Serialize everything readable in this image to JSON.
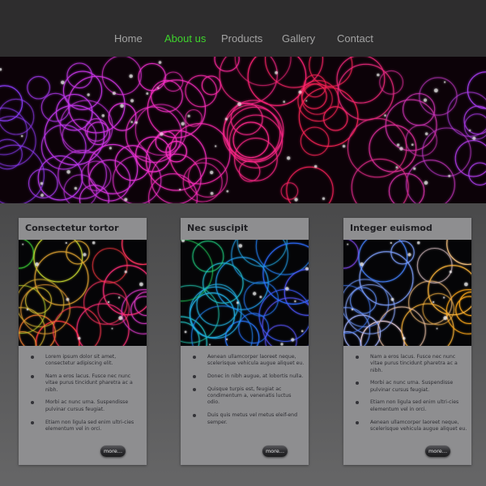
{
  "nav": {
    "items": [
      {
        "label": "Home",
        "active": false
      },
      {
        "label": "About us",
        "active": true
      },
      {
        "label": "Products",
        "active": false
      },
      {
        "label": "Gallery",
        "active": false
      },
      {
        "label": "Contact",
        "active": false
      }
    ],
    "active_color": "#3ed42c",
    "inactive_color": "#a3a3a3"
  },
  "banner": {
    "image": "glowing-circles-world-map",
    "palette": [
      "#8a3cff",
      "#ff2fd0",
      "#ff2050",
      "#b040ff"
    ]
  },
  "cards": [
    {
      "title": "Consectetur tortor",
      "image": "glowing-circles-rainbow",
      "items": [
        "Lorem ipsum dolor sit amet, consectetur adipiscing elit.",
        "Nam a eros lacus. Fusce nec nunc vitae purus tincidunt pharetra ac a nibh.",
        "Morbi ac nunc urna. Suspendisse pulvinar cursus feugiat.",
        "Etiam non ligula sed enim ultri-cies elementum vel in orci."
      ],
      "more_label": "more..."
    },
    {
      "title": "Nec suscipit",
      "image": "glowing-circles-green-blue",
      "items": [
        "Aenean ullamcorper laoreet neque, scelerisque vehicula augue aliquet eu.",
        "Donec in nibh augue, at lobortis nulla.",
        "Quisque turpis est, feugiat ac condimentum a, venenatis luctus odio.",
        "Duis quis metus vel metus eleif-end semper."
      ],
      "more_label": "more..."
    },
    {
      "title": "Integer euismod",
      "image": "glowing-circles-blue-orange",
      "items": [
        "Nam a eros lacus. Fusce nec nunc vitae purus tincidunt pharetra ac a nibh.",
        "Morbi ac nunc urna. Suspendisse pulvinar cursus feugiat.",
        "Etiam non ligula sed enim ultri-cies elementum vel in orci.",
        "Aenean ullamcorper laoreet neque, scelerisque vehicula augue aliquet eu."
      ],
      "more_label": "more..."
    }
  ]
}
